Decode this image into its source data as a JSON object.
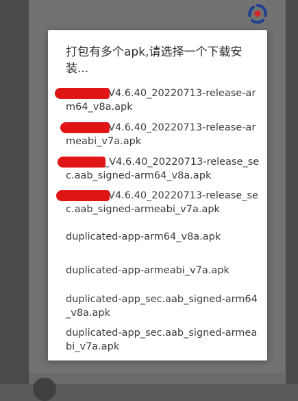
{
  "dialog": {
    "title": "打包有多个apk,请选择一个下载安装...",
    "options": [
      {
        "label": "V4.6.40_20220713-release-arm64_v8a.apk"
      },
      {
        "label": "V4.6.40_20220713-release-armeabi_v7a.apk"
      },
      {
        "label": "_V4.6.40_20220713-release_sec.aab_signed-arm64_v8a.apk"
      },
      {
        "label": "V4.6.40_20220713-release_sec.aab_signed-armeabi_v7a.apk"
      },
      {
        "label": "duplicated-app-arm64_v8a.apk"
      },
      {
        "label": "duplicated-app-armeabi_v7a.apk"
      },
      {
        "label": "duplicated-app_sec.aab_signed-arm64_v8a.apk"
      },
      {
        "label": "duplicated-app_sec.aab_signed-armeabi_v7a.apk"
      }
    ]
  },
  "colors": {
    "redaction": "#e01515",
    "logo_blue": "#1e3f8f",
    "logo_red": "#d9262b"
  },
  "icons": {
    "app_logo": "app-logo-icon"
  }
}
